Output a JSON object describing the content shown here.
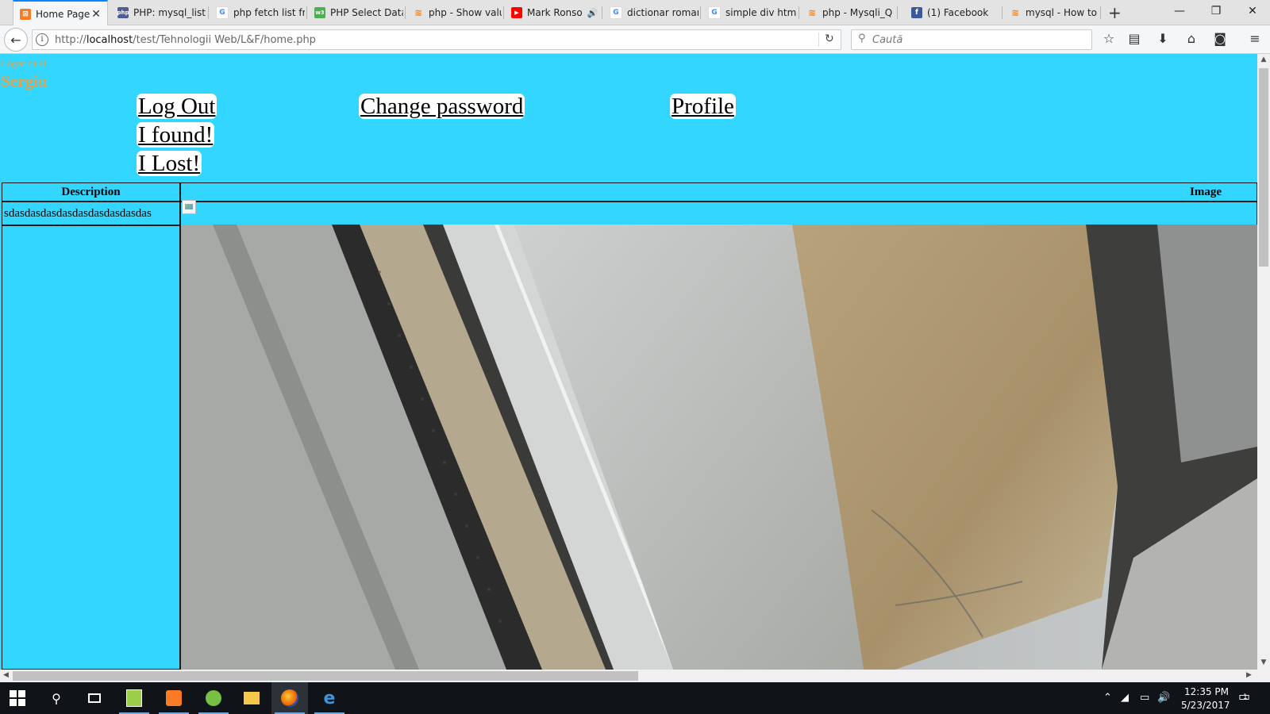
{
  "browser": {
    "tabs": [
      {
        "label": "Home Page",
        "active": true,
        "favicon": "xampp-icon",
        "color": "#fb7a24"
      },
      {
        "label": "PHP: mysql_list",
        "favicon": "php-icon",
        "color": "#4f5b93"
      },
      {
        "label": "php fetch list fro",
        "favicon": "google-icon",
        "color": "#4285f4"
      },
      {
        "label": "PHP Select Data",
        "favicon": "w3schools-icon",
        "color": "#4caf50"
      },
      {
        "label": "php - Show valu",
        "favicon": "stackoverflow-icon",
        "color": "#f48024"
      },
      {
        "label": "Mark Ronso",
        "favicon": "youtube-icon",
        "color": "#ff0000",
        "audio": true
      },
      {
        "label": "dictionar roman",
        "favicon": "google-icon",
        "color": "#4285f4"
      },
      {
        "label": "simple div html",
        "favicon": "google-icon",
        "color": "#4285f4"
      },
      {
        "label": "php - Mysqli_Q",
        "favicon": "stackoverflow-icon",
        "color": "#f48024"
      },
      {
        "label": "(1) Facebook",
        "favicon": "facebook-icon",
        "color": "#3b5998"
      },
      {
        "label": "mysql - How to",
        "favicon": "stackoverflow-icon",
        "color": "#f48024"
      }
    ],
    "url_prefix": "http://",
    "url_host": "localhost",
    "url_path": "/test/Tehnologii Web/L&F/home.php",
    "search_placeholder": "Caută"
  },
  "page": {
    "logged_label": "Logat ca si",
    "username": "Sergiu",
    "links": {
      "logout": "Log Out",
      "change_password": "Change password",
      "profile": "Profile",
      "found": "I found!",
      "lost": "I Lost!"
    },
    "table": {
      "headers": {
        "description": "Description",
        "image": "Image"
      },
      "rows": [
        {
          "description": "sdasdasdasdasdasdasdasdasdas"
        }
      ]
    },
    "colors": {
      "background": "#33d6ff",
      "accent": "#e6a24a"
    }
  },
  "taskbar": {
    "time": "12:35 PM",
    "date": "5/23/2017",
    "notification_count": "1"
  }
}
